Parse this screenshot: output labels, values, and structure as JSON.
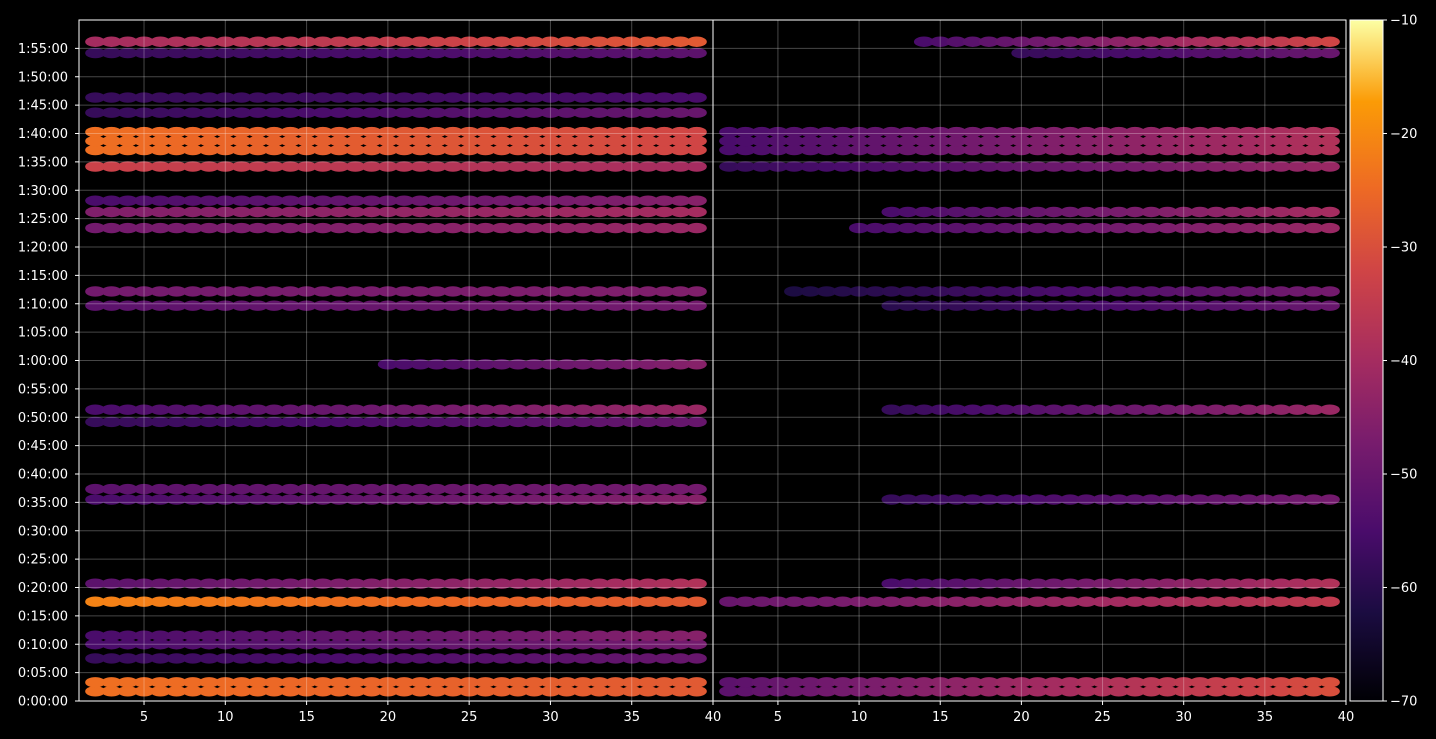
{
  "chart_data": {
    "type": "heatmap",
    "title": "",
    "xlabel": "",
    "ylabel": "",
    "grid": true,
    "background": "#000000",
    "colormap": "inferno",
    "colorbar": {
      "range": [
        -70,
        -10
      ],
      "ticks": [
        -10,
        -20,
        -30,
        -40,
        -50,
        -60,
        -70
      ],
      "tick_labels": [
        "−10",
        "−20",
        "−30",
        "−40",
        "−50",
        "−60",
        "−70"
      ]
    },
    "y_axis": {
      "range_seconds": [
        0,
        7200
      ],
      "ticks_seconds": [
        0,
        300,
        600,
        900,
        1200,
        1500,
        1800,
        2100,
        2400,
        2700,
        3000,
        3300,
        3600,
        3900,
        4200,
        4500,
        4800,
        5100,
        5400,
        5700,
        6000,
        6300,
        6600,
        6900
      ],
      "tick_labels": [
        "0:00:00",
        "0:05:00",
        "0:10:00",
        "0:15:00",
        "0:20:00",
        "0:25:00",
        "0:30:00",
        "0:35:00",
        "0:40:00",
        "0:45:00",
        "0:50:00",
        "0:55:00",
        "1:00:00",
        "1:05:00",
        "1:10:00",
        "1:15:00",
        "1:20:00",
        "1:25:00",
        "1:30:00",
        "1:35:00",
        "1:40:00",
        "1:45:00",
        "1:50:00",
        "1:55:00"
      ]
    },
    "panels": [
      {
        "xlim": [
          1,
          40
        ],
        "x_ticks": [
          5,
          10,
          15,
          20,
          25,
          30,
          35,
          40
        ],
        "x_tick_labels": [
          "5",
          "10",
          "15",
          "20",
          "25",
          "30",
          "35",
          "40"
        ],
        "bands": [
          {
            "t": 150,
            "x": [
              2,
              39
            ],
            "v_start": -24,
            "v_end": -28,
            "thick": 2
          },
          {
            "t": 450,
            "x": [
              2,
              39
            ],
            "v_start": -58,
            "v_end": -50,
            "thick": 1
          },
          {
            "t": 600,
            "x": [
              2,
              39
            ],
            "v_start": -55,
            "v_end": -48,
            "thick": 1
          },
          {
            "t": 690,
            "x": [
              2,
              39
            ],
            "v_start": -55,
            "v_end": -45,
            "thick": 1
          },
          {
            "t": 1050,
            "x": [
              2,
              39
            ],
            "v_start": -21,
            "v_end": -28,
            "thick": 1
          },
          {
            "t": 1240,
            "x": [
              2,
              39
            ],
            "v_start": -52,
            "v_end": -38,
            "thick": 1
          },
          {
            "t": 2130,
            "x": [
              2,
              39
            ],
            "v_start": -55,
            "v_end": -45,
            "thick": 1
          },
          {
            "t": 2240,
            "x": [
              2,
              39
            ],
            "v_start": -52,
            "v_end": -48,
            "thick": 1
          },
          {
            "t": 2950,
            "x": [
              2,
              39
            ],
            "v_start": -58,
            "v_end": -50,
            "thick": 1
          },
          {
            "t": 3080,
            "x": [
              2,
              39
            ],
            "v_start": -55,
            "v_end": -42,
            "thick": 1
          },
          {
            "t": 3560,
            "x": [
              20,
              39
            ],
            "v_start": -55,
            "v_end": -45,
            "thick": 1
          },
          {
            "t": 4180,
            "x": [
              2,
              39
            ],
            "v_start": -52,
            "v_end": -48,
            "thick": 1
          },
          {
            "t": 4330,
            "x": [
              2,
              39
            ],
            "v_start": -48,
            "v_end": -46,
            "thick": 1
          },
          {
            "t": 5000,
            "x": [
              2,
              39
            ],
            "v_start": -48,
            "v_end": -42,
            "thick": 1
          },
          {
            "t": 5170,
            "x": [
              2,
              39
            ],
            "v_start": -46,
            "v_end": -40,
            "thick": 1
          },
          {
            "t": 5290,
            "x": [
              2,
              39
            ],
            "v_start": -55,
            "v_end": -45,
            "thick": 1
          },
          {
            "t": 5650,
            "x": [
              2,
              39
            ],
            "v_start": -33,
            "v_end": -40,
            "thick": 1
          },
          {
            "t": 5920,
            "x": [
              2,
              39
            ],
            "v_start": -24,
            "v_end": -32,
            "thick": 3
          },
          {
            "t": 6220,
            "x": [
              2,
              39
            ],
            "v_start": -58,
            "v_end": -50,
            "thick": 1
          },
          {
            "t": 6380,
            "x": [
              2,
              39
            ],
            "v_start": -58,
            "v_end": -55,
            "thick": 1
          },
          {
            "t": 6850,
            "x": [
              2,
              39
            ],
            "v_start": -58,
            "v_end": -52,
            "thick": 1
          },
          {
            "t": 6970,
            "x": [
              2,
              39
            ],
            "v_start": -40,
            "v_end": -28,
            "thick": 1
          }
        ]
      },
      {
        "xlim": [
          1,
          40
        ],
        "x_ticks": [
          5,
          10,
          15,
          20,
          25,
          30,
          35,
          40
        ],
        "x_tick_labels": [
          "5",
          "10",
          "15",
          "20",
          "25",
          "30",
          "35",
          "40"
        ],
        "bands": [
          {
            "t": 150,
            "x": [
              2,
              39
            ],
            "v_start": -52,
            "v_end": -30,
            "thick": 2
          },
          {
            "t": 1050,
            "x": [
              2,
              39
            ],
            "v_start": -50,
            "v_end": -35,
            "thick": 1
          },
          {
            "t": 1240,
            "x": [
              12,
              39
            ],
            "v_start": -55,
            "v_end": -38,
            "thick": 1
          },
          {
            "t": 2130,
            "x": [
              12,
              39
            ],
            "v_start": -58,
            "v_end": -48,
            "thick": 1
          },
          {
            "t": 3080,
            "x": [
              12,
              39
            ],
            "v_start": -58,
            "v_end": -42,
            "thick": 1
          },
          {
            "t": 4180,
            "x": [
              12,
              39
            ],
            "v_start": -60,
            "v_end": -50,
            "thick": 1
          },
          {
            "t": 4330,
            "x": [
              6,
              39
            ],
            "v_start": -62,
            "v_end": -48,
            "thick": 1
          },
          {
            "t": 5000,
            "x": [
              10,
              39
            ],
            "v_start": -55,
            "v_end": -42,
            "thick": 1
          },
          {
            "t": 5170,
            "x": [
              12,
              39
            ],
            "v_start": -55,
            "v_end": -40,
            "thick": 1
          },
          {
            "t": 5650,
            "x": [
              2,
              39
            ],
            "v_start": -58,
            "v_end": -42,
            "thick": 1
          },
          {
            "t": 5920,
            "x": [
              2,
              39
            ],
            "v_start": -55,
            "v_end": -38,
            "thick": 3
          },
          {
            "t": 6850,
            "x": [
              20,
              39
            ],
            "v_start": -58,
            "v_end": -50,
            "thick": 1
          },
          {
            "t": 6970,
            "x": [
              14,
              39
            ],
            "v_start": -55,
            "v_end": -32,
            "thick": 1
          }
        ]
      }
    ]
  }
}
